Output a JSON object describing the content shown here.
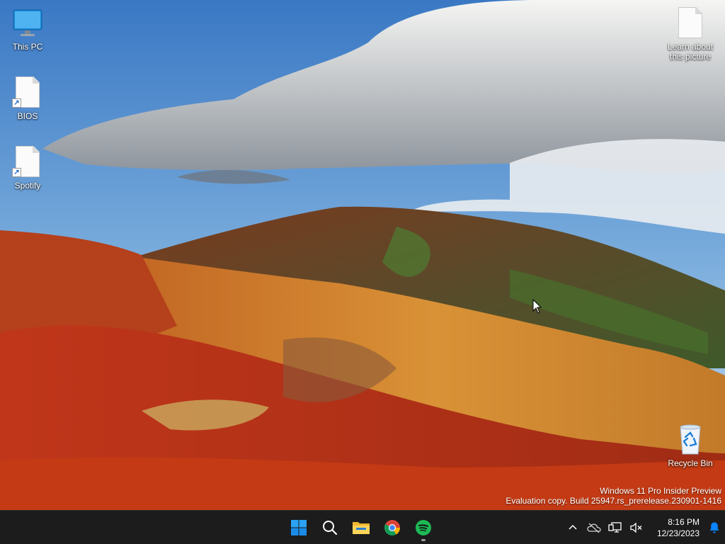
{
  "desktop": {
    "icons_left": [
      {
        "label": "This PC"
      },
      {
        "label": "BIOS"
      },
      {
        "label": "Spotify"
      }
    ],
    "icons_right": [
      {
        "label": "Learn about this picture"
      },
      {
        "label": "Recycle Bin"
      }
    ]
  },
  "watermark": {
    "line1": "Windows 11 Pro Insider Preview",
    "line2": "Evaluation copy. Build 25947.rs_prerelease.230901-1416"
  },
  "taskbar": {
    "pinned": [
      {
        "icon": "windows-start-icon"
      },
      {
        "icon": "search-icon"
      },
      {
        "icon": "file-explorer-icon"
      },
      {
        "icon": "chrome-icon"
      },
      {
        "icon": "spotify-icon"
      }
    ],
    "tray": {
      "chevron": "chevron-up-icon",
      "onedrive": "cloud-off-icon",
      "network": "network-icon",
      "volume": "volume-muted-icon"
    },
    "clock": {
      "time": "8:16 PM",
      "date": "12/23/2023"
    },
    "notification": "bell-icon"
  },
  "colors": {
    "taskbar_bg": "#1c1c1c",
    "accent_blue": "#0a84ff",
    "spotify_green": "#1db954"
  }
}
